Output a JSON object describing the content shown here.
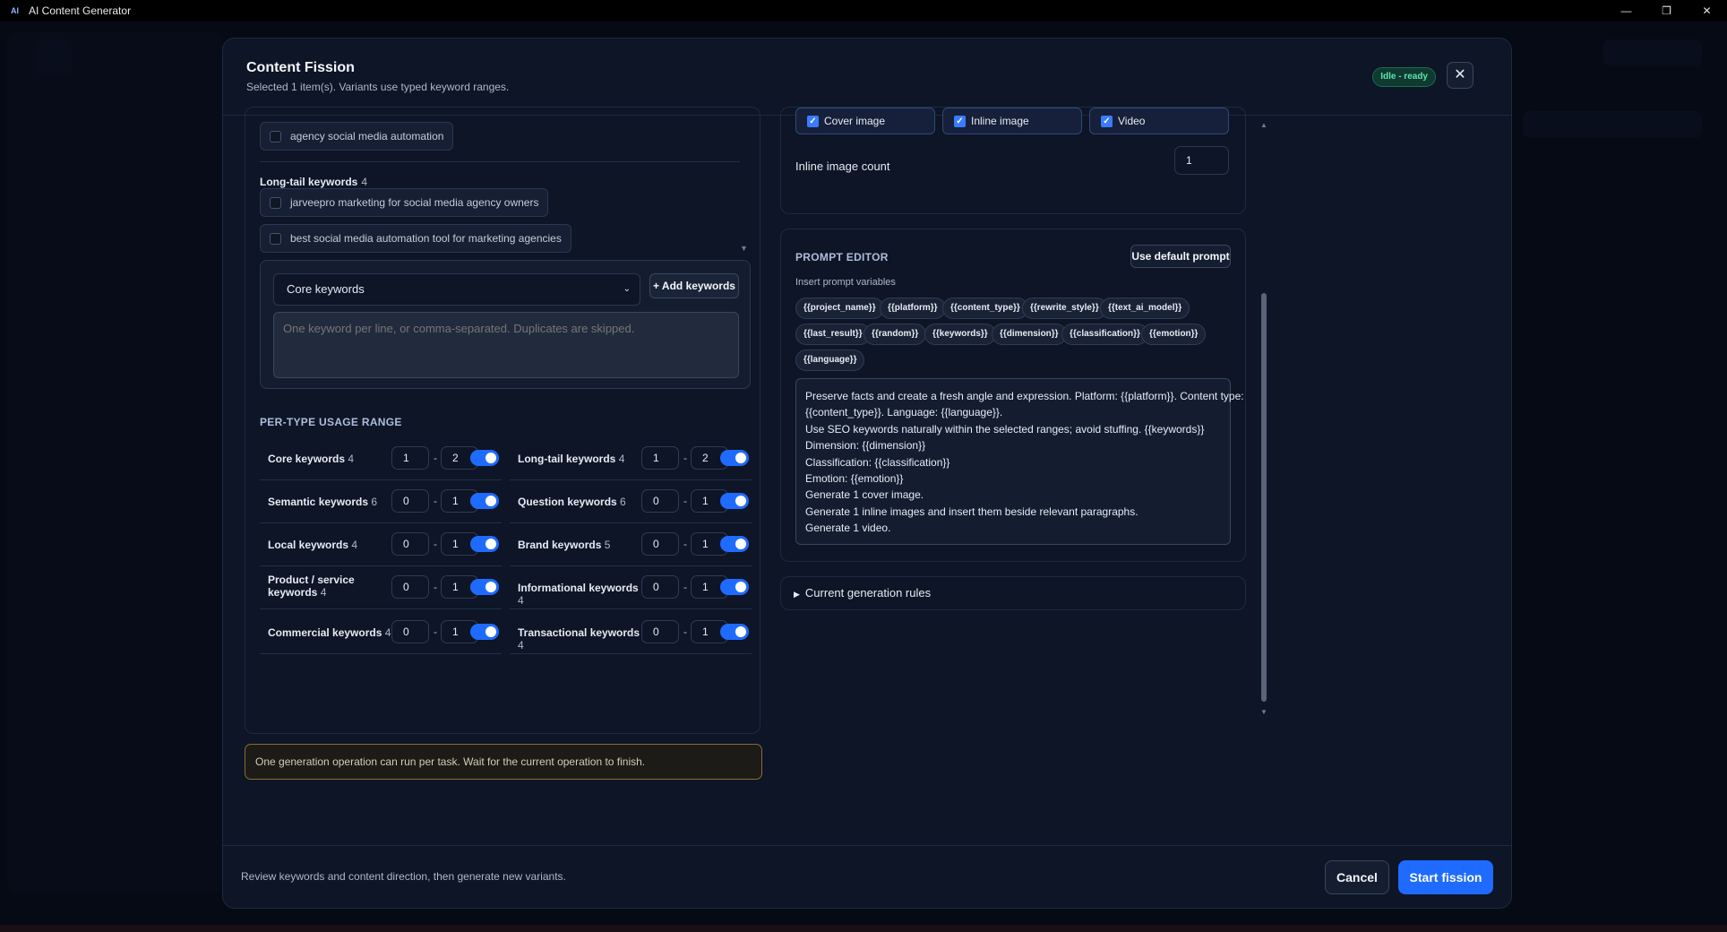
{
  "window": {
    "title": "AI Content Generator",
    "icon_name": "app-icon"
  },
  "modal": {
    "title": "Content Fission",
    "subtitle": "Selected 1 item(s). Variants use typed keyword ranges.",
    "status": "Idle - ready"
  },
  "keywords": {
    "top_chip": "agency social media automation",
    "longtail_label": "Long-tail keywords",
    "longtail_count": "4",
    "longtail_items": [
      "jarveepro marketing for social media agency owners",
      "best social media automation tool for marketing agencies"
    ],
    "type_select": "Core keywords",
    "add_button": "+ Add keywords",
    "textarea_placeholder": "One keyword per line, or comma-separated. Duplicates are skipped."
  },
  "usage": {
    "heading": "PER-TYPE USAGE RANGE",
    "rows": [
      {
        "name": "Core keywords",
        "count": "4",
        "min": "1",
        "max": "2"
      },
      {
        "name": "Long-tail keywords",
        "count": "4",
        "min": "1",
        "max": "2"
      },
      {
        "name": "Semantic keywords",
        "count": "6",
        "min": "0",
        "max": "1"
      },
      {
        "name": "Question keywords",
        "count": "6",
        "min": "0",
        "max": "1"
      },
      {
        "name": "Local keywords",
        "count": "4",
        "min": "0",
        "max": "1"
      },
      {
        "name": "Brand keywords",
        "count": "5",
        "min": "0",
        "max": "1"
      },
      {
        "name": "Product / service keywords",
        "count": "4",
        "min": "0",
        "max": "1"
      },
      {
        "name": "Informational keywords",
        "count": "4",
        "min": "0",
        "max": "1"
      },
      {
        "name": "Commercial keywords",
        "count": "4",
        "min": "0",
        "max": "1"
      },
      {
        "name": "Transactional keywords",
        "count": "4",
        "min": "0",
        "max": "1"
      }
    ],
    "dash": "-"
  },
  "warning": "One generation operation can run per task. Wait for the current operation to finish.",
  "media": {
    "options": [
      "Cover image",
      "Inline image",
      "Video"
    ],
    "inline_count_label": "Inline image count",
    "inline_count": "1"
  },
  "prompt": {
    "title": "PROMPT EDITOR",
    "default_button": "Use default prompt",
    "vars_label": "Insert prompt variables",
    "variables": [
      "{{project_name}}",
      "{{platform}}",
      "{{content_type}}",
      "{{rewrite_style}}",
      "{{text_ai_model}}",
      "{{last_result}}",
      "{{random}}",
      "{{keywords}}",
      "{{dimension}}",
      "{{classification}}",
      "{{emotion}}",
      "{{language}}"
    ],
    "lines": [
      "Preserve facts and create a fresh angle and expression. Platform: {{platform}}. Content type:",
      "{{content_type}}. Language: {{language}}.",
      "Use SEO keywords naturally within the selected ranges; avoid stuffing. {{keywords}}",
      "Dimension: {{dimension}}",
      "Classification: {{classification}}",
      "Emotion: {{emotion}}",
      "Generate 1 cover image.",
      "Generate 1 inline images and insert them beside relevant paragraphs.",
      "Generate 1 video."
    ]
  },
  "rules": {
    "label": "Current generation rules"
  },
  "footer": {
    "note": "Review keywords and content direction, then generate new variants.",
    "cancel": "Cancel",
    "start": "Start fission"
  }
}
